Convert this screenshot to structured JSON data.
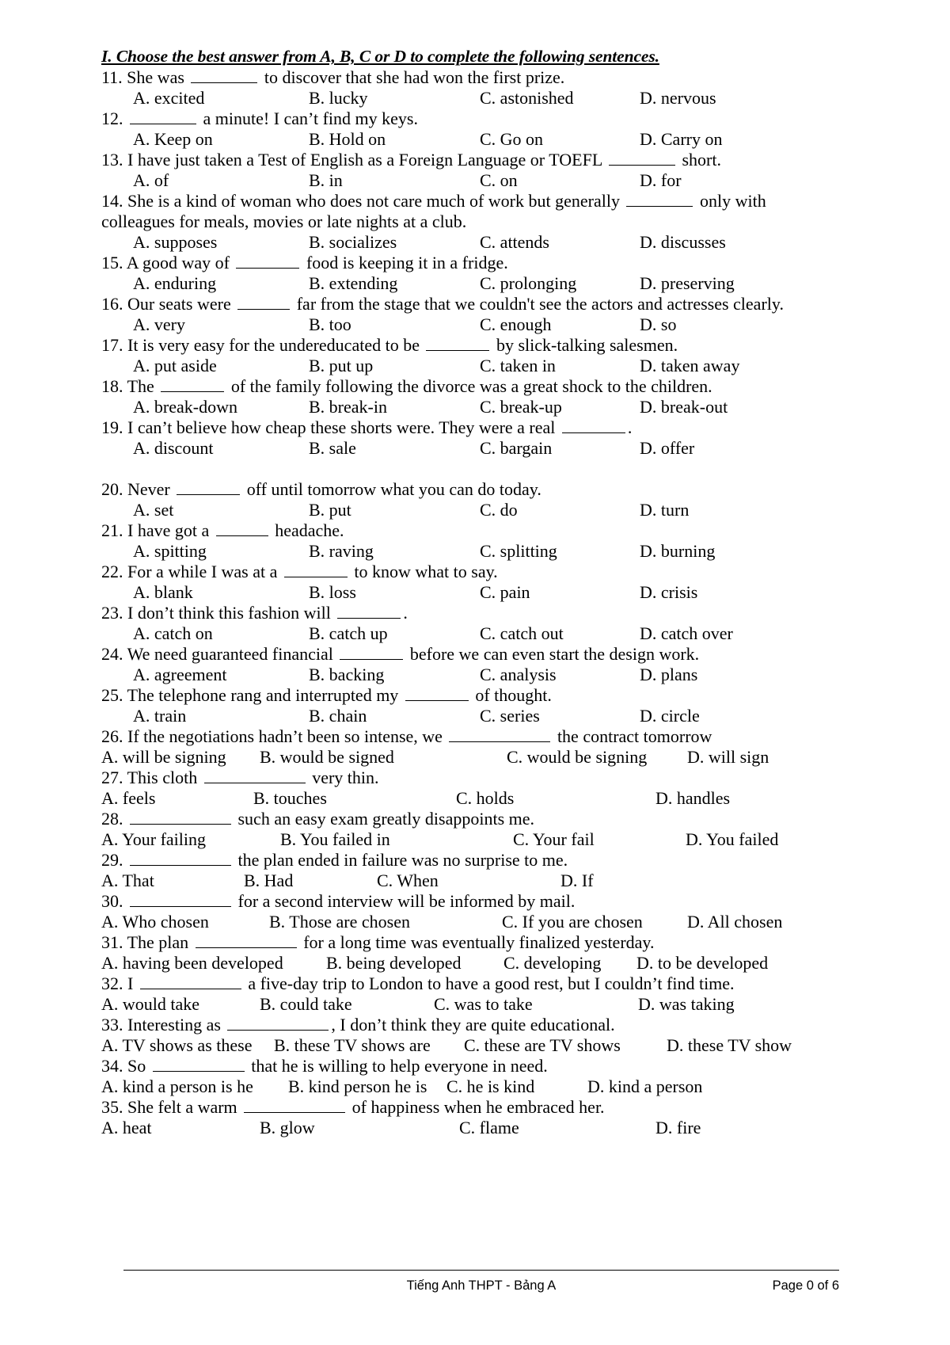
{
  "document": {
    "section_heading": "I. Choose the best answer from A, B, C or D to complete the following sentences."
  },
  "questions": [
    {
      "number": "11.",
      "stem_before": "11. She was ",
      "stem_after": " to discover that she had won the first prize.",
      "blank_width": 84,
      "options": [
        "A. excited",
        "B. lucky",
        "C. astonished",
        "D. nervous"
      ],
      "layout": "indent"
    },
    {
      "number": "12.",
      "stem_before": "12. ",
      "stem_after": " a minute! I can’t find my keys.",
      "blank_width": 84,
      "options": [
        "A. Keep on",
        "B. Hold on",
        "C. Go on",
        "D. Carry on"
      ],
      "layout": "indent"
    },
    {
      "number": "13.",
      "stem_before": "13. I have just taken a Test of English as a Foreign Language or TOEFL ",
      "stem_after": " short.",
      "blank_width": 84,
      "options": [
        "A. of",
        "B. in",
        "C. on",
        "D. for"
      ],
      "layout": "indent"
    },
    {
      "number": "14.",
      "stem_before": "14. She is a kind of woman who does not care much of work but generally ",
      "stem_after": " only with colleagues for meals, movies or late nights at a club.",
      "blank_width": 84,
      "options": [
        "A. supposes",
        "B. socializes",
        "C. attends",
        "D. discusses"
      ],
      "layout": "indent",
      "wrap": true
    },
    {
      "number": "15.",
      "stem_before": "15. A good way of ",
      "stem_after": " food is keeping it in a fridge.",
      "blank_width": 80,
      "options": [
        "A. enduring",
        "B. extending",
        "C. prolonging",
        "D. preserving"
      ],
      "layout": "indent"
    },
    {
      "number": "16.",
      "stem_before": "16. Our seats were ",
      "stem_after": " far from the stage that we couldn't see the actors and actresses clearly.",
      "blank_width": 66,
      "options": [
        "A. very",
        "B. too",
        "C. enough",
        "D. so"
      ],
      "layout": "indent"
    },
    {
      "number": "17.",
      "stem_before": "17. It is very easy for the undereducated to be ",
      "stem_after": " by slick-talking salesmen.",
      "blank_width": 80,
      "options": [
        "A. put aside",
        "B. put up",
        "C. taken in",
        "D. taken away"
      ],
      "layout": "indent"
    },
    {
      "number": "18.",
      "stem_before": "18. The ",
      "stem_after": " of the family following the divorce was a great shock to the children.",
      "blank_width": 80,
      "options": [
        "A. break-down",
        "B. break-in",
        "C. break-up",
        "D. break-out"
      ],
      "layout": "indent"
    },
    {
      "number": "19.",
      "stem_before": "19. I can’t believe how cheap these shorts were. They were a real ",
      "stem_after": ".",
      "blank_width": 80,
      "options": [
        "A. discount",
        "B. sale",
        "C. bargain",
        "D. offer"
      ],
      "layout": "indent",
      "gap_after": true
    },
    {
      "number": "20.",
      "stem_before": "20. Never ",
      "stem_after": " off until tomorrow what you can do today.",
      "blank_width": 80,
      "options": [
        "A. set",
        "B. put",
        "C. do",
        "D. turn"
      ],
      "layout": "indent"
    },
    {
      "number": "21.",
      "stem_before": "21. I have got a ",
      "stem_after": " headache.",
      "blank_width": 66,
      "options": [
        "A. spitting",
        "B. raving",
        "C. splitting",
        "D. burning"
      ],
      "layout": "indent"
    },
    {
      "number": "22.",
      "stem_before": "22. For a while I was at a ",
      "stem_after": " to know what to say.",
      "blank_width": 80,
      "options": [
        "A. blank",
        "B. loss",
        "C. pain",
        "D. crisis"
      ],
      "layout": "indent"
    },
    {
      "number": "23.",
      "stem_before": "23. I don’t think this fashion will ",
      "stem_after": ".",
      "blank_width": 80,
      "options": [
        "A. catch on",
        "B. catch up",
        "C. catch out",
        "D. catch over"
      ],
      "layout": "indent"
    },
    {
      "number": "24.",
      "stem_before": "24. We need guaranteed financial ",
      "stem_after": " before we can even start the design work.",
      "blank_width": 80,
      "options": [
        "A. agreement",
        "B. backing",
        "C. analysis",
        "D. plans"
      ],
      "layout": "indent"
    },
    {
      "number": "25.",
      "stem_before": "25. The telephone rang and interrupted my ",
      "stem_after": " of thought.",
      "blank_width": 80,
      "options": [
        "A. train",
        "B. chain",
        "C. series",
        "D. circle"
      ],
      "layout": "indent"
    },
    {
      "number": "26.",
      "stem_before": "26. If the negotiations hadn’t been so intense, we ",
      "stem_after": " the contract tomorrow",
      "blank_width": 128,
      "options": [
        "A. will be signing",
        "B. would be signed",
        "C. would be signing",
        "D. will sign"
      ],
      "layout": "flush",
      "option_x": [
        0,
        200,
        512,
        740
      ]
    },
    {
      "number": "27.",
      "stem_before": "27. This cloth ",
      "stem_after": " very thin.",
      "blank_width": 128,
      "options": [
        "A. feels",
        "B. touches",
        "C. holds",
        "D. handles"
      ],
      "layout": "flush",
      "option_x": [
        0,
        192,
        448,
        700
      ]
    },
    {
      "number": "28.",
      "stem_before": "28. ",
      "stem_after": " such an easy exam greatly disappoints me.",
      "blank_width": 128,
      "options": [
        "A. Your failing",
        "B. You failed in",
        "C. Your fail",
        "D. You failed"
      ],
      "layout": "flush",
      "option_x": [
        0,
        226,
        520,
        738
      ]
    },
    {
      "number": "29.",
      "stem_before": "29. ",
      "stem_after": " the plan ended in failure was no surprise to me.",
      "blank_width": 128,
      "options": [
        "A. That",
        "B. Had",
        "C. When",
        "D. If"
      ],
      "layout": "flush",
      "option_x": [
        0,
        180,
        348,
        580
      ]
    },
    {
      "number": "30.",
      "stem_before": "30. ",
      "stem_after": " for a second interview will be informed by mail.",
      "blank_width": 128,
      "options": [
        "A. Who chosen",
        "B. Those are chosen",
        "C. If you are chosen",
        "D. All chosen"
      ],
      "layout": "flush",
      "option_x": [
        0,
        212,
        506,
        740
      ]
    },
    {
      "number": "31.",
      "stem_before": "31. The plan ",
      "stem_after": " for a long time was eventually finalized yesterday.",
      "blank_width": 128,
      "options": [
        "A. having been developed",
        "B. being developed",
        "C. developing",
        "D. to be developed"
      ],
      "layout": "flush",
      "option_x": [
        0,
        284,
        508,
        676
      ]
    },
    {
      "number": "32.",
      "stem_before": "32. I ",
      "stem_after": " a five-day trip to London to have a good rest, but I couldn’t find time.",
      "blank_width": 128,
      "options": [
        "A. would take",
        "B. could take",
        "C. was to take",
        "D. was taking"
      ],
      "layout": "flush",
      "option_x": [
        0,
        200,
        420,
        678
      ]
    },
    {
      "number": "33.",
      "stem_before": "33. Interesting as ",
      "stem_after": ", I don’t think they are quite educational.",
      "blank_width": 128,
      "options": [
        "A. TV shows as these",
        "B. these TV shows are",
        "C. these are TV shows",
        "D. these TV show"
      ],
      "layout": "flush",
      "option_x": [
        0,
        218,
        458,
        714
      ]
    },
    {
      "number": "34.",
      "stem_before": "34. So ",
      "stem_after": " that he is willing to help everyone in need.",
      "blank_width": 116,
      "options": [
        "A. kind a person is he",
        "B. kind person he is",
        "C. he is kind",
        "D. kind a person"
      ],
      "layout": "flush",
      "option_x": [
        0,
        236,
        436,
        614
      ]
    },
    {
      "number": "35.",
      "stem_before": "35. She felt a warm ",
      "stem_after": " of happiness when he embraced her.",
      "blank_width": 128,
      "options": [
        "A. heat",
        "B. glow",
        "C. flame",
        "D. fire"
      ],
      "layout": "flush",
      "option_x": [
        0,
        200,
        452,
        700
      ]
    }
  ],
  "footer": {
    "center": "Tiếng Anh THPT - Bảng A",
    "right": "Page 0 of 6"
  }
}
